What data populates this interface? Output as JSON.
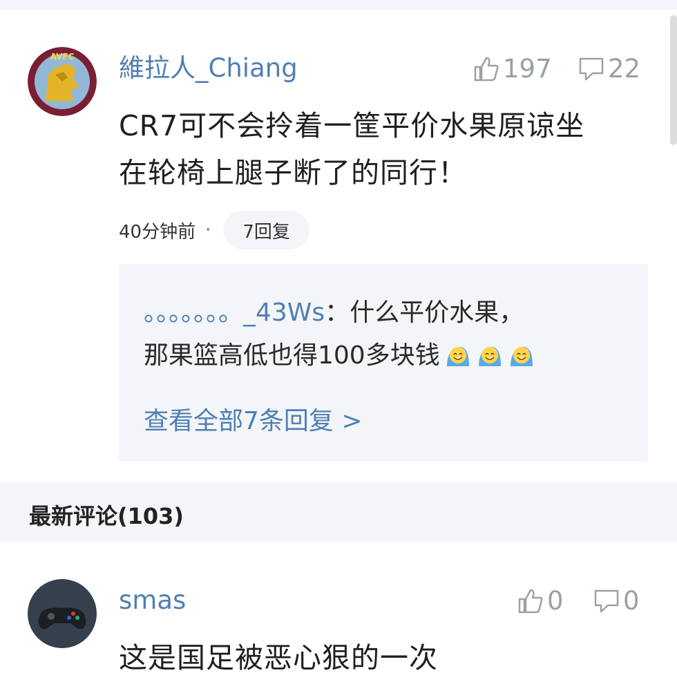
{
  "comments": [
    {
      "username": "維拉人_Chiang",
      "likes": "197",
      "replies_count": "22",
      "text_line1": "CR7可不会拎着一筐平价水果原谅坐",
      "text_line2": "在轮椅上腿子断了的同行！",
      "time": "40分钟前",
      "reply_pill": "7回复",
      "preview_reply": {
        "user": "。。。。。。。_43Ws",
        "separator": "：",
        "text1": "什么平价水果，",
        "text2": "那果篮高低也得100多块钱",
        "emoji_icon": "grin-sweat-emoji"
      },
      "view_all": "查看全部7条回复 >"
    },
    {
      "username": "smas",
      "likes": "0",
      "replies_count": "0",
      "text_line1": "这是国足被恶心狠的一次"
    }
  ],
  "section": {
    "title": "最新评论(103)"
  },
  "colors": {
    "link": "#4f7fb4",
    "band": "#f3f5f8",
    "muted": "#9aa0a6"
  }
}
